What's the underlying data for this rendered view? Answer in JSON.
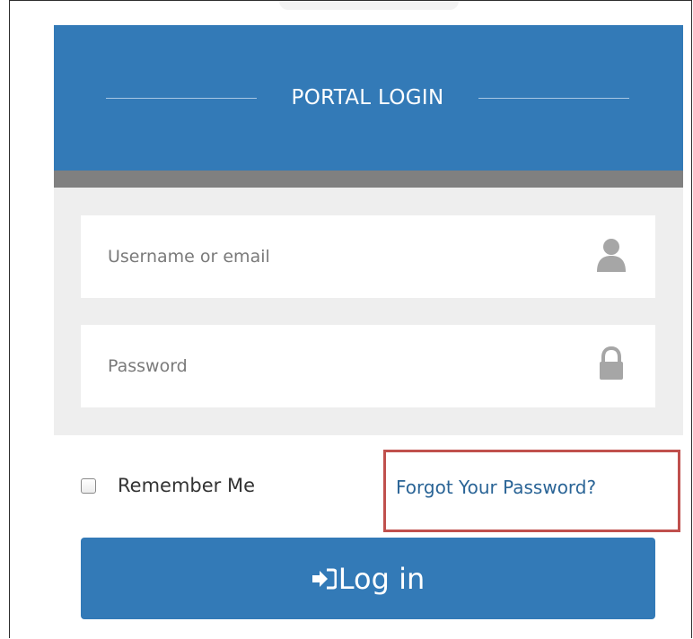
{
  "login": {
    "title": "PORTAL LOGIN",
    "username_placeholder": "Username or email",
    "password_placeholder": "Password",
    "remember_label": "Remember Me",
    "forgot_label": "Forgot Your Password?",
    "login_label": "Log in",
    "icons": {
      "username": "user-icon",
      "password": "lock-icon",
      "login": "sign-in-icon"
    }
  },
  "colors": {
    "primary": "#337ab7",
    "strip": "#808080",
    "card_bg": "#eeeeee",
    "link": "#2a6496",
    "highlight": "#c0504d"
  }
}
